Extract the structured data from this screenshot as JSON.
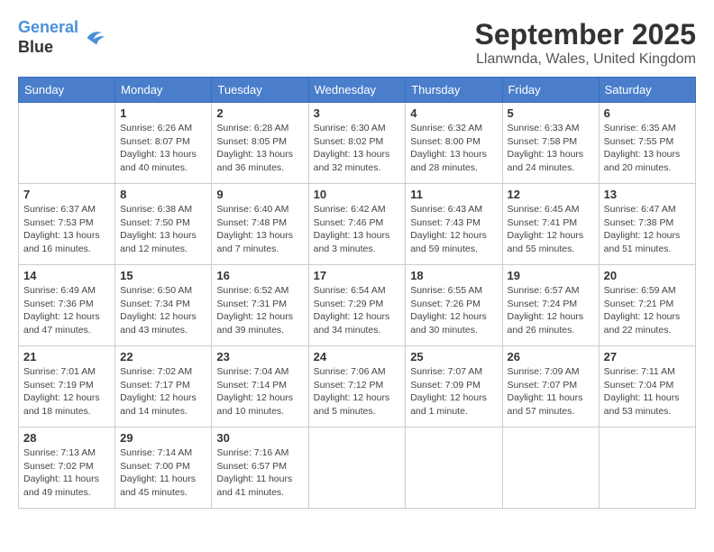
{
  "header": {
    "logo_line1": "General",
    "logo_line2": "Blue",
    "month": "September 2025",
    "location": "Llanwnda, Wales, United Kingdom"
  },
  "weekdays": [
    "Sunday",
    "Monday",
    "Tuesday",
    "Wednesday",
    "Thursday",
    "Friday",
    "Saturday"
  ],
  "weeks": [
    [
      {
        "day": "",
        "sunrise": "",
        "sunset": "",
        "daylight": ""
      },
      {
        "day": "1",
        "sunrise": "Sunrise: 6:26 AM",
        "sunset": "Sunset: 8:07 PM",
        "daylight": "Daylight: 13 hours and 40 minutes."
      },
      {
        "day": "2",
        "sunrise": "Sunrise: 6:28 AM",
        "sunset": "Sunset: 8:05 PM",
        "daylight": "Daylight: 13 hours and 36 minutes."
      },
      {
        "day": "3",
        "sunrise": "Sunrise: 6:30 AM",
        "sunset": "Sunset: 8:02 PM",
        "daylight": "Daylight: 13 hours and 32 minutes."
      },
      {
        "day": "4",
        "sunrise": "Sunrise: 6:32 AM",
        "sunset": "Sunset: 8:00 PM",
        "daylight": "Daylight: 13 hours and 28 minutes."
      },
      {
        "day": "5",
        "sunrise": "Sunrise: 6:33 AM",
        "sunset": "Sunset: 7:58 PM",
        "daylight": "Daylight: 13 hours and 24 minutes."
      },
      {
        "day": "6",
        "sunrise": "Sunrise: 6:35 AM",
        "sunset": "Sunset: 7:55 PM",
        "daylight": "Daylight: 13 hours and 20 minutes."
      }
    ],
    [
      {
        "day": "7",
        "sunrise": "Sunrise: 6:37 AM",
        "sunset": "Sunset: 7:53 PM",
        "daylight": "Daylight: 13 hours and 16 minutes."
      },
      {
        "day": "8",
        "sunrise": "Sunrise: 6:38 AM",
        "sunset": "Sunset: 7:50 PM",
        "daylight": "Daylight: 13 hours and 12 minutes."
      },
      {
        "day": "9",
        "sunrise": "Sunrise: 6:40 AM",
        "sunset": "Sunset: 7:48 PM",
        "daylight": "Daylight: 13 hours and 7 minutes."
      },
      {
        "day": "10",
        "sunrise": "Sunrise: 6:42 AM",
        "sunset": "Sunset: 7:46 PM",
        "daylight": "Daylight: 13 hours and 3 minutes."
      },
      {
        "day": "11",
        "sunrise": "Sunrise: 6:43 AM",
        "sunset": "Sunset: 7:43 PM",
        "daylight": "Daylight: 12 hours and 59 minutes."
      },
      {
        "day": "12",
        "sunrise": "Sunrise: 6:45 AM",
        "sunset": "Sunset: 7:41 PM",
        "daylight": "Daylight: 12 hours and 55 minutes."
      },
      {
        "day": "13",
        "sunrise": "Sunrise: 6:47 AM",
        "sunset": "Sunset: 7:38 PM",
        "daylight": "Daylight: 12 hours and 51 minutes."
      }
    ],
    [
      {
        "day": "14",
        "sunrise": "Sunrise: 6:49 AM",
        "sunset": "Sunset: 7:36 PM",
        "daylight": "Daylight: 12 hours and 47 minutes."
      },
      {
        "day": "15",
        "sunrise": "Sunrise: 6:50 AM",
        "sunset": "Sunset: 7:34 PM",
        "daylight": "Daylight: 12 hours and 43 minutes."
      },
      {
        "day": "16",
        "sunrise": "Sunrise: 6:52 AM",
        "sunset": "Sunset: 7:31 PM",
        "daylight": "Daylight: 12 hours and 39 minutes."
      },
      {
        "day": "17",
        "sunrise": "Sunrise: 6:54 AM",
        "sunset": "Sunset: 7:29 PM",
        "daylight": "Daylight: 12 hours and 34 minutes."
      },
      {
        "day": "18",
        "sunrise": "Sunrise: 6:55 AM",
        "sunset": "Sunset: 7:26 PM",
        "daylight": "Daylight: 12 hours and 30 minutes."
      },
      {
        "day": "19",
        "sunrise": "Sunrise: 6:57 AM",
        "sunset": "Sunset: 7:24 PM",
        "daylight": "Daylight: 12 hours and 26 minutes."
      },
      {
        "day": "20",
        "sunrise": "Sunrise: 6:59 AM",
        "sunset": "Sunset: 7:21 PM",
        "daylight": "Daylight: 12 hours and 22 minutes."
      }
    ],
    [
      {
        "day": "21",
        "sunrise": "Sunrise: 7:01 AM",
        "sunset": "Sunset: 7:19 PM",
        "daylight": "Daylight: 12 hours and 18 minutes."
      },
      {
        "day": "22",
        "sunrise": "Sunrise: 7:02 AM",
        "sunset": "Sunset: 7:17 PM",
        "daylight": "Daylight: 12 hours and 14 minutes."
      },
      {
        "day": "23",
        "sunrise": "Sunrise: 7:04 AM",
        "sunset": "Sunset: 7:14 PM",
        "daylight": "Daylight: 12 hours and 10 minutes."
      },
      {
        "day": "24",
        "sunrise": "Sunrise: 7:06 AM",
        "sunset": "Sunset: 7:12 PM",
        "daylight": "Daylight: 12 hours and 5 minutes."
      },
      {
        "day": "25",
        "sunrise": "Sunrise: 7:07 AM",
        "sunset": "Sunset: 7:09 PM",
        "daylight": "Daylight: 12 hours and 1 minute."
      },
      {
        "day": "26",
        "sunrise": "Sunrise: 7:09 AM",
        "sunset": "Sunset: 7:07 PM",
        "daylight": "Daylight: 11 hours and 57 minutes."
      },
      {
        "day": "27",
        "sunrise": "Sunrise: 7:11 AM",
        "sunset": "Sunset: 7:04 PM",
        "daylight": "Daylight: 11 hours and 53 minutes."
      }
    ],
    [
      {
        "day": "28",
        "sunrise": "Sunrise: 7:13 AM",
        "sunset": "Sunset: 7:02 PM",
        "daylight": "Daylight: 11 hours and 49 minutes."
      },
      {
        "day": "29",
        "sunrise": "Sunrise: 7:14 AM",
        "sunset": "Sunset: 7:00 PM",
        "daylight": "Daylight: 11 hours and 45 minutes."
      },
      {
        "day": "30",
        "sunrise": "Sunrise: 7:16 AM",
        "sunset": "Sunset: 6:57 PM",
        "daylight": "Daylight: 11 hours and 41 minutes."
      },
      {
        "day": "",
        "sunrise": "",
        "sunset": "",
        "daylight": ""
      },
      {
        "day": "",
        "sunrise": "",
        "sunset": "",
        "daylight": ""
      },
      {
        "day": "",
        "sunrise": "",
        "sunset": "",
        "daylight": ""
      },
      {
        "day": "",
        "sunrise": "",
        "sunset": "",
        "daylight": ""
      }
    ]
  ]
}
